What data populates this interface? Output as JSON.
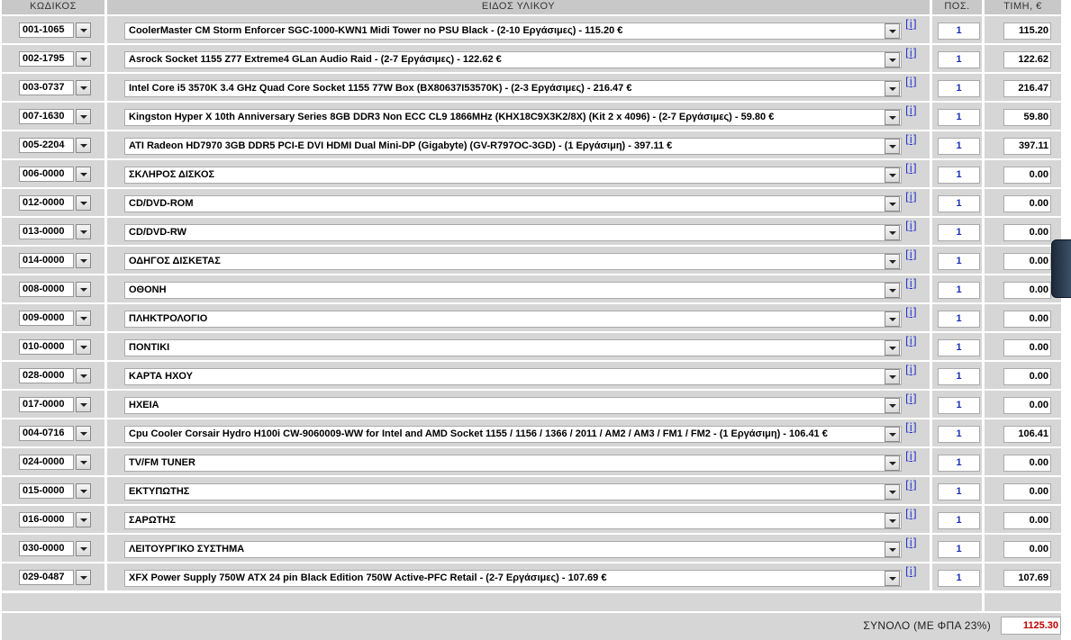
{
  "headers": {
    "code": "ΚΩΔΙΚΟΣ",
    "description": "ΕΙΔΟΣ ΥΛΙΚΟΥ",
    "quantity": "ΠΟΣ.",
    "price": "ΤΙΜΗ, €"
  },
  "info_link": "[i]",
  "rows": [
    {
      "code": "001-1065",
      "description": "CoolerMaster CM Storm Enforcer SGC-1000-KWN1 Midi Tower no PSU Black - (2-10 Εργάσιμες) - 115.20 €",
      "qty": "1",
      "price": "115.20"
    },
    {
      "code": "002-1795",
      "description": "Asrock Socket 1155 Z77 Extreme4 GLan Audio Raid - (2-7 Εργάσιμες) - 122.62 €",
      "qty": "1",
      "price": "122.62"
    },
    {
      "code": "003-0737",
      "description": "Intel Core i5 3570K 3.4 GHz Quad Core Socket 1155 77W Box (BX80637I53570K) - (2-3 Εργάσιμες) - 216.47 €",
      "qty": "1",
      "price": "216.47"
    },
    {
      "code": "007-1630",
      "description": "Kingston Hyper X 10th Anniversary Series 8GB DDR3 Non ECC CL9 1866MHz (KHX18C9X3K2/8X) (Kit 2 x 4096) - (2-7 Εργάσιμες) - 59.80 €",
      "qty": "1",
      "price": "59.80"
    },
    {
      "code": "005-2204",
      "description": "ATI Radeon HD7970 3GB DDR5 PCI-E DVI HDMI Dual Mini-DP (Gigabyte) (GV-R797OC-3GD) - (1 Εργάσιμη) - 397.11 €",
      "qty": "1",
      "price": "397.11"
    },
    {
      "code": "006-0000",
      "description": "ΣΚΛΗΡΟΣ ΔΙΣΚΟΣ",
      "qty": "1",
      "price": "0.00"
    },
    {
      "code": "012-0000",
      "description": "CD/DVD-ROM",
      "qty": "1",
      "price": "0.00"
    },
    {
      "code": "013-0000",
      "description": "CD/DVD-RW",
      "qty": "1",
      "price": "0.00"
    },
    {
      "code": "014-0000",
      "description": "ΟΔΗΓΟΣ ΔΙΣΚΕΤΑΣ",
      "qty": "1",
      "price": "0.00"
    },
    {
      "code": "008-0000",
      "description": "ΟΘΟΝΗ",
      "qty": "1",
      "price": "0.00"
    },
    {
      "code": "009-0000",
      "description": "ΠΛΗΚΤΡΟΛΟΓΙΟ",
      "qty": "1",
      "price": "0.00"
    },
    {
      "code": "010-0000",
      "description": "ΠΟΝΤΙΚΙ",
      "qty": "1",
      "price": "0.00"
    },
    {
      "code": "028-0000",
      "description": "ΚΑΡΤΑ ΗΧΟΥ",
      "qty": "1",
      "price": "0.00"
    },
    {
      "code": "017-0000",
      "description": "ΗΧΕΙΑ",
      "qty": "1",
      "price": "0.00"
    },
    {
      "code": "004-0716",
      "description": "Cpu Cooler Corsair Hydro H100i CW-9060009-WW for Intel and AMD Socket 1155 / 1156 / 1366 / 2011 / AM2 / AM3 / FM1 / FM2 - (1 Εργάσιμη) - 106.41 €",
      "qty": "1",
      "price": "106.41"
    },
    {
      "code": "024-0000",
      "description": "TV/FM TUNER",
      "qty": "1",
      "price": "0.00"
    },
    {
      "code": "015-0000",
      "description": "ΕΚΤΥΠΩΤΗΣ",
      "qty": "1",
      "price": "0.00"
    },
    {
      "code": "016-0000",
      "description": "ΣΑΡΩΤΗΣ",
      "qty": "1",
      "price": "0.00"
    },
    {
      "code": "030-0000",
      "description": "ΛΕΙΤΟΥΡΓΙΚΟ ΣΥΣΤΗΜΑ",
      "qty": "1",
      "price": "0.00"
    },
    {
      "code": "029-0487",
      "description": "XFX Power Supply 750W ATX 24 pin Black Edition 750W Active-PFC Retail - (2-7 Εργάσιμες) - 107.69 €",
      "qty": "1",
      "price": "107.69"
    }
  ],
  "total": {
    "label": "ΣΥΝΟΛΟ (ΜΕ ΦΠΑ 23%)",
    "value": "1125.30",
    "value_color": "#c00000"
  },
  "colors": {
    "header_bg": "#c8c8c8",
    "cell_bg": "#d6d6d6",
    "qty_text": "#1a2fb0",
    "info_link": "#2233cc"
  }
}
